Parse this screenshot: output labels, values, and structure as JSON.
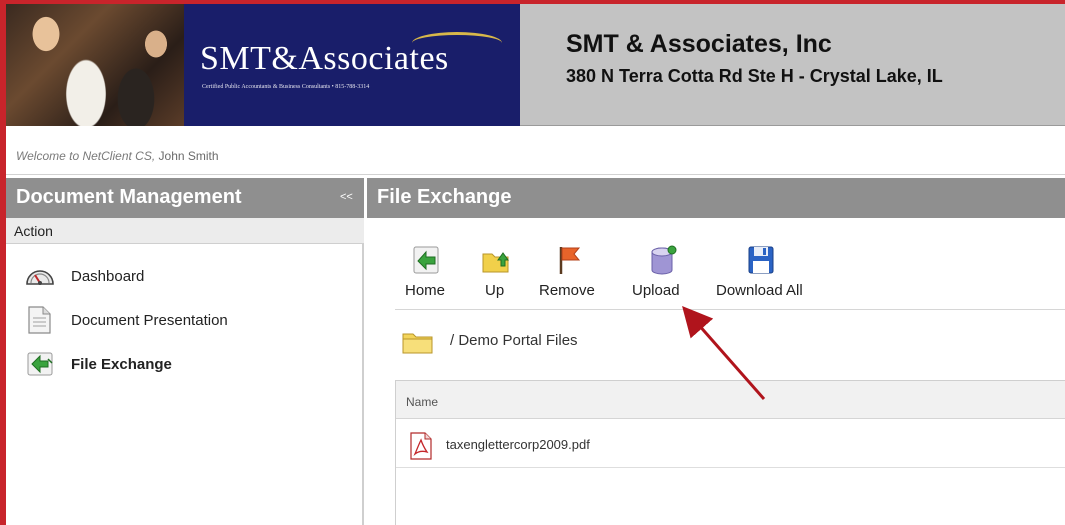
{
  "header": {
    "logo_text": "SMT&Associates",
    "logo_tagline": "Certified Public Accountants & Business Consultants • 815-788-3314",
    "company_name": "SMT & Associates, Inc",
    "company_address": "380 N Terra Cotta Rd Ste H - Crystal Lake, IL"
  },
  "welcome": {
    "prefix": "Welcome to NetClient CS,",
    "user": "John Smith"
  },
  "sidebar": {
    "title": "Document Management",
    "collapse_label": "<<",
    "section_label": "Action",
    "items": [
      {
        "label": "Dashboard",
        "icon": "dashboard-gauge-icon",
        "active": false
      },
      {
        "label": "Document Presentation",
        "icon": "document-icon",
        "active": false
      },
      {
        "label": "File Exchange",
        "icon": "file-exchange-icon",
        "active": true
      }
    ]
  },
  "main": {
    "title": "File Exchange",
    "toolbar": [
      {
        "label": "Home",
        "icon": "home-exchange-icon"
      },
      {
        "label": "Up",
        "icon": "folder-up-icon"
      },
      {
        "label": "Remove",
        "icon": "flag-remove-icon"
      },
      {
        "label": "Upload",
        "icon": "upload-cylinder-icon"
      },
      {
        "label": "Download All",
        "icon": "floppy-disk-icon"
      }
    ],
    "breadcrumb": "/ Demo Portal Files",
    "grid": {
      "column_name": "Name",
      "rows": [
        {
          "filename": "taxenglettercorp2009.pdf",
          "icon": "pdf-icon"
        }
      ]
    }
  },
  "colors": {
    "frame_red": "#c8242b",
    "logo_navy": "#191e6a",
    "panel_header_gray": "#8f8f8f",
    "header_gray": "#c3c3c3",
    "annotation_arrow": "#b0141c"
  }
}
